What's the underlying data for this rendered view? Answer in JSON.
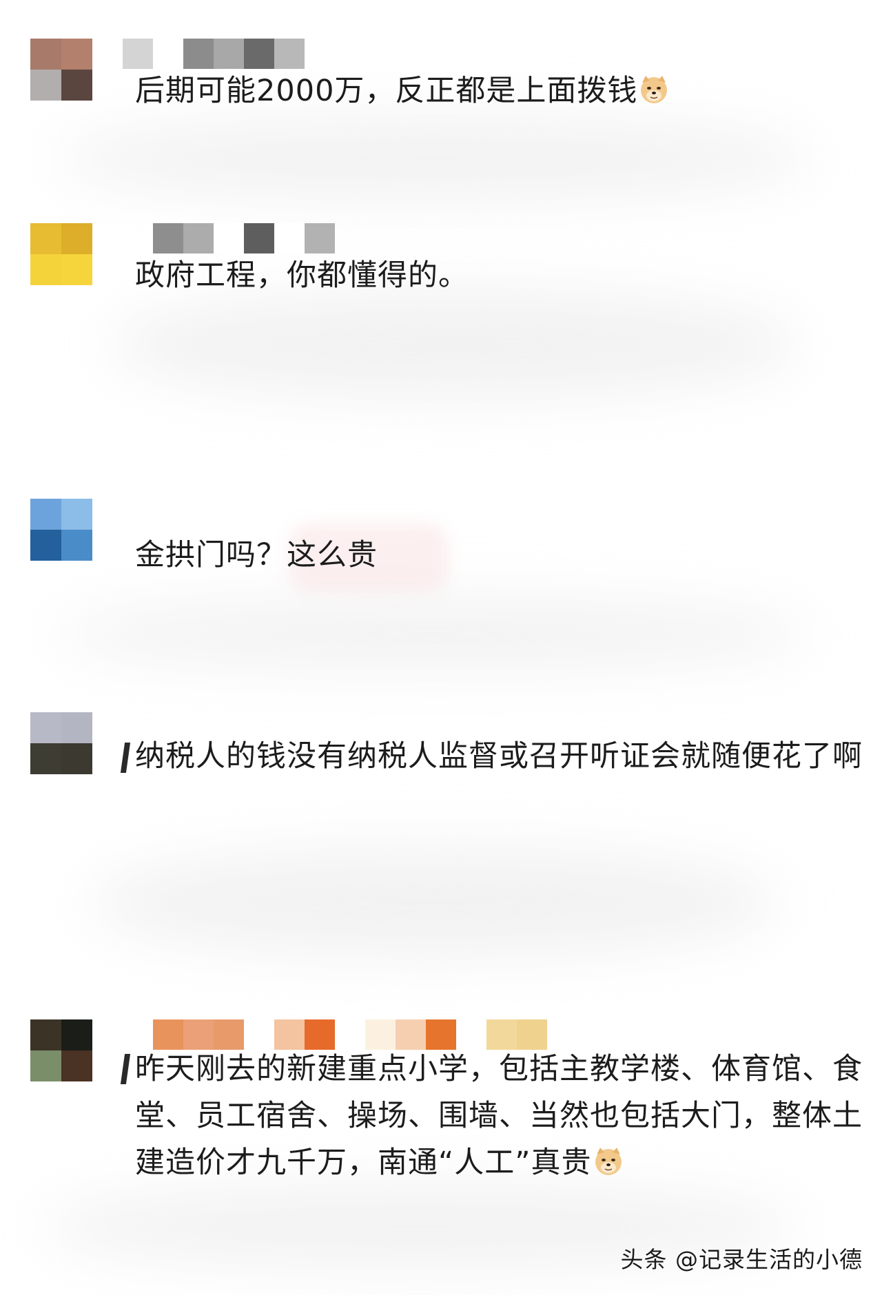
{
  "comments": [
    {
      "text": "后期可能2000万，反正都是上面拨钱",
      "emoji": "doge-emoji",
      "avatar_colors": [
        "#a87a6a",
        "#b3806d",
        "#b2aeae",
        "#5a463f"
      ],
      "name_colors": [
        "#d4d4d4",
        "#ffffff",
        "#8c8c8c",
        "#a8a8a8",
        "#6a6a6a",
        "#b8b8b8"
      ]
    },
    {
      "text": "政府工程，你都懂得的。",
      "emoji": "",
      "avatar_colors": [
        "#e8bc32",
        "#dcae2a",
        "#f4d33a",
        "#f6d53c"
      ],
      "name_colors": [
        "#8e8e8e",
        "#acacac",
        "#ffffff",
        "#5e5e5e",
        "#ffffff",
        "#b2b2b2"
      ]
    },
    {
      "text": "金拱门吗？这么贵",
      "emoji": "",
      "avatar_colors": [
        "#6da3dc",
        "#8cbce8",
        "#23609c",
        "#4a8cc8"
      ],
      "name_colors": []
    },
    {
      "text": "纳税人的钱没有纳税人监督或召开听证会就随便花了啊",
      "emoji": "",
      "avatar_colors": [
        "#b8b9c6",
        "#b4b5c2",
        "#3e3d34",
        "#3c3a30"
      ],
      "name_colors": []
    },
    {
      "text": "昨天刚去的新建重点小学，包括主教学楼、体育馆、食堂、员工宿舍、操场、围墙、当然也包括大门，整体土建造价才九千万，南通“人工”真贵",
      "emoji": "doge-emoji",
      "avatar_colors": [
        "#3c3327",
        "#1b1d18",
        "#7b8e6a",
        "#4a3224"
      ],
      "name_colors": [
        "#e8935c",
        "#eba077",
        "#e89a6a",
        "#ffffff",
        "#f4c3a0",
        "#e66a2a",
        "#ffffff",
        "#fcf1e0",
        "#f6cfb0",
        "#e6742c",
        "#ffffff",
        "#f2d89a",
        "#efd28e"
      ]
    }
  ],
  "watermark": "头条 @记录生活的小德"
}
